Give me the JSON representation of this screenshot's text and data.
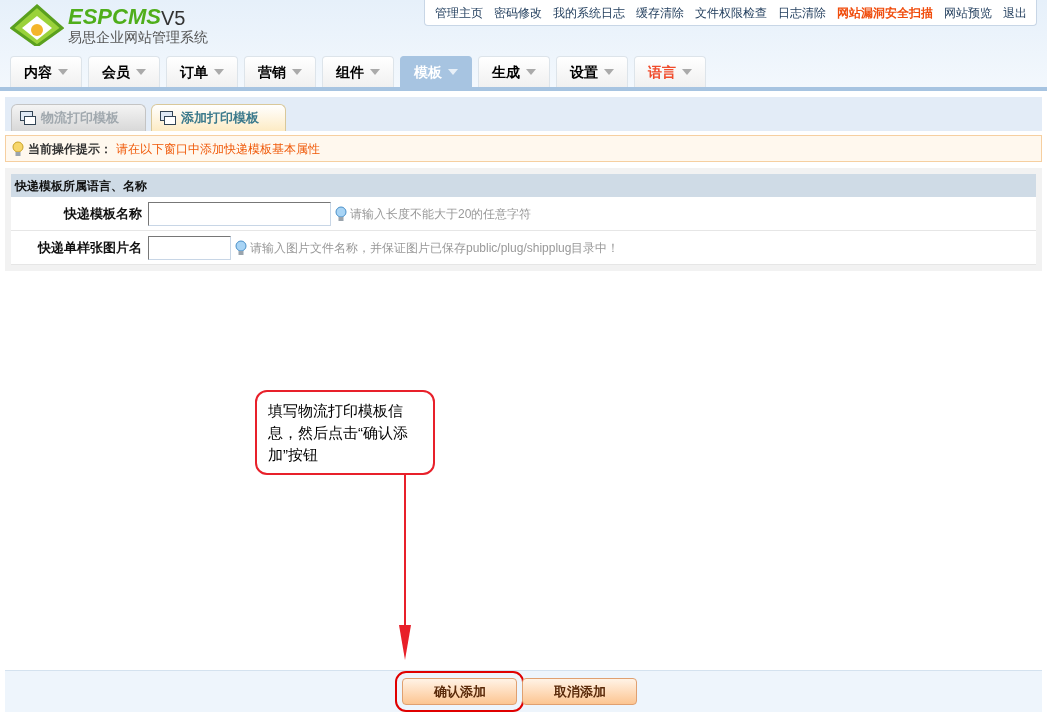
{
  "logo": {
    "brand": "ESPCMS",
    "version": "V5",
    "subtitle": "易思企业网站管理系统"
  },
  "top_links": [
    {
      "label": "管理主页",
      "emphasized": false
    },
    {
      "label": "密码修改",
      "emphasized": false
    },
    {
      "label": "我的系统日志",
      "emphasized": false
    },
    {
      "label": "缓存清除",
      "emphasized": false
    },
    {
      "label": "文件权限检查",
      "emphasized": false
    },
    {
      "label": "日志清除",
      "emphasized": false
    },
    {
      "label": "网站漏洞安全扫描",
      "emphasized": true
    },
    {
      "label": "网站预览",
      "emphasized": false
    },
    {
      "label": "退出",
      "emphasized": false
    }
  ],
  "nav_tabs": [
    {
      "label": "内容",
      "selected": false,
      "emphasized": false
    },
    {
      "label": "会员",
      "selected": false,
      "emphasized": false
    },
    {
      "label": "订单",
      "selected": false,
      "emphasized": false
    },
    {
      "label": "营销",
      "selected": false,
      "emphasized": false
    },
    {
      "label": "组件",
      "selected": false,
      "emphasized": false
    },
    {
      "label": "模板",
      "selected": true,
      "emphasized": false
    },
    {
      "label": "生成",
      "selected": false,
      "emphasized": false
    },
    {
      "label": "设置",
      "selected": false,
      "emphasized": false
    },
    {
      "label": "语言",
      "selected": false,
      "emphasized": true
    }
  ],
  "sub_tabs": [
    {
      "label": "物流打印模板",
      "selected": false
    },
    {
      "label": "添加打印模板",
      "selected": true
    }
  ],
  "tip": {
    "label": "当前操作提示：",
    "text": "请在以下窗口中添加快递模板基本属性"
  },
  "form": {
    "title": "快递模板所属语言、名称",
    "fields": [
      {
        "label": "快递模板名称",
        "kind": "wide",
        "hint": "请输入长度不能大于20的任意字符"
      },
      {
        "label": "快递单样张图片名",
        "kind": "narrow",
        "hint": "请输入图片文件名称，并保证图片已保存public/plug/shipplug目录中！"
      }
    ]
  },
  "callout": "填写物流打印模板信息，然后点击“确认添加”按钮",
  "buttons": [
    {
      "label": "确认添加",
      "highlighted": true
    },
    {
      "label": "取消添加",
      "highlighted": false
    }
  ]
}
